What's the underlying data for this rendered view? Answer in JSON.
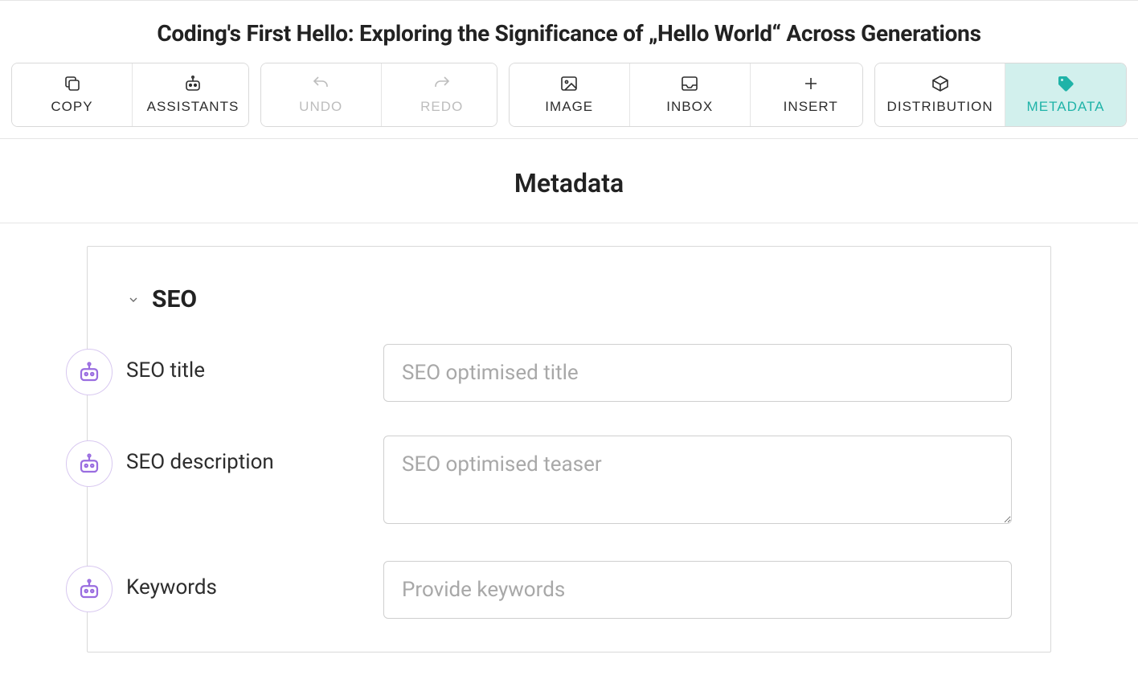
{
  "header": {
    "title": "Coding's First Hello: Exploring the Significance of „Hello World“ Across Generations"
  },
  "toolbar": {
    "copy": "COPY",
    "assistants": "ASSISTANTS",
    "undo": "UNDO",
    "redo": "REDO",
    "image": "IMAGE",
    "inbox": "INBOX",
    "insert": "INSERT",
    "distribution": "DISTRIBUTION",
    "metadata": "METADATA"
  },
  "section": {
    "title": "Metadata",
    "group": "SEO",
    "fields": {
      "seo_title": {
        "label": "SEO title",
        "placeholder": "SEO optimised title",
        "value": ""
      },
      "seo_description": {
        "label": "SEO description",
        "placeholder": "SEO optimised teaser",
        "value": ""
      },
      "keywords": {
        "label": "Keywords",
        "placeholder": "Provide keywords",
        "value": ""
      }
    }
  }
}
